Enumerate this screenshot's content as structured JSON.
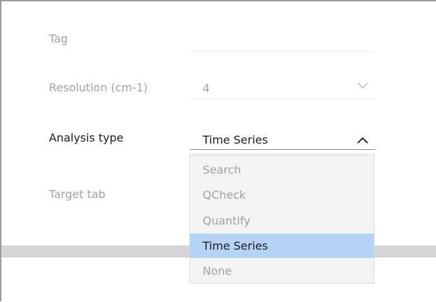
{
  "form": {
    "tag": {
      "label": "Tag",
      "value": ""
    },
    "resolution": {
      "label": "Resolution (cm-1)",
      "value": "4"
    },
    "analysis_type": {
      "label": "Analysis type",
      "value": "Time Series"
    },
    "target_tab": {
      "label": "Target tab"
    }
  },
  "dropdown": {
    "options": [
      {
        "label": "Search"
      },
      {
        "label": "QCheck"
      },
      {
        "label": "Quantify"
      },
      {
        "label": "Time Series",
        "selected": true
      },
      {
        "label": "None"
      }
    ]
  },
  "icons": {
    "resolution_chevron": "chevron-down-icon",
    "analysis_chevron": "chevron-up-icon"
  },
  "colors": {
    "selected_highlight": "#b5d3f4",
    "muted_text": "#a3a3a3",
    "active_text": "#1e1e1e"
  }
}
